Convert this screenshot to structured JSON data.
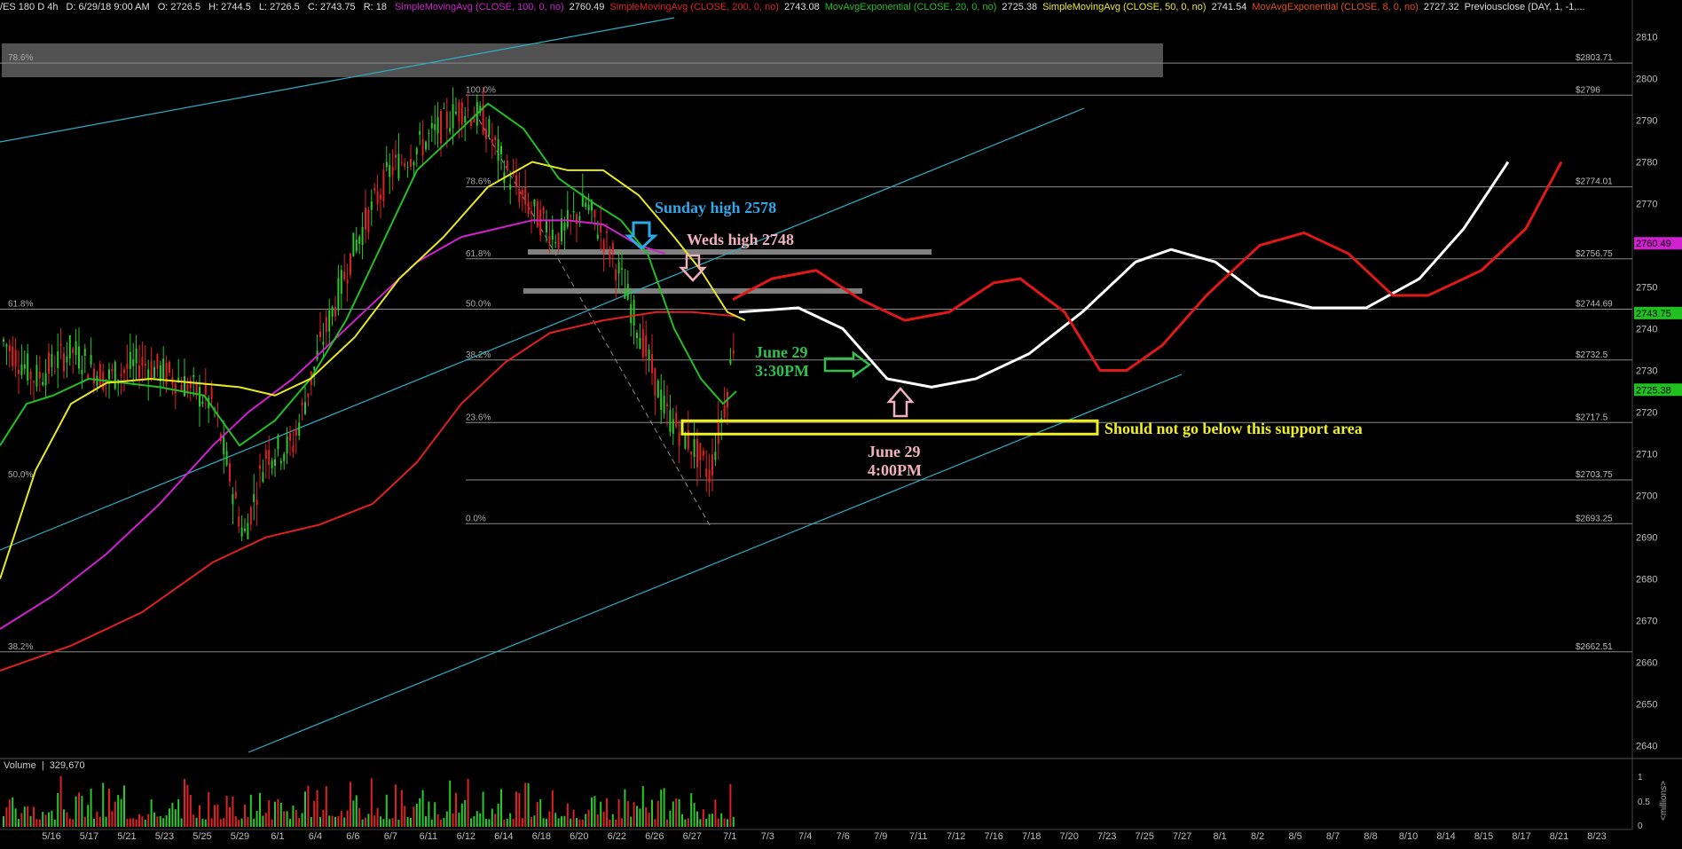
{
  "header": {
    "symbol": "/ES 180 D 4h",
    "date": "D: 6/29/18 9:00 AM",
    "open": "O: 2726.5",
    "high": "H: 2744.5",
    "low": "L: 2726.5",
    "close": "C: 2743.75",
    "range": "R: 18",
    "studies": [
      {
        "label": "SimpleMovingAvg (CLOSE, 100, 0, no)",
        "value": "2760.49",
        "color": "#d020d0"
      },
      {
        "label": "SimpleMovingAvg (CLOSE, 200, 0, no)",
        "value": "2743.08",
        "color": "#e02020"
      },
      {
        "label": "MovAvgExponential (CLOSE, 20, 0, no)",
        "value": "2725.38",
        "color": "#20c020"
      },
      {
        "label": "SimpleMovingAvg (CLOSE, 50, 0, no)",
        "value": "2741.54",
        "color": "#e8e820"
      },
      {
        "label": "MovAvgExponential (CLOSE, 8, 0, no)",
        "value": "2727.32",
        "color": "#e05010"
      },
      {
        "label": "Previousclose (DAY, 1, -1,...",
        "value": "",
        "color": "#dddddd"
      }
    ]
  },
  "chart_data": {
    "type": "line",
    "x_ticks": [
      "5/16",
      "5/17",
      "5/21",
      "5/23",
      "5/25",
      "5/29",
      "6/1",
      "6/4",
      "6/6",
      "6/7",
      "6/11",
      "6/12",
      "6/14",
      "6/18",
      "6/20",
      "6/22",
      "6/26",
      "6/27",
      "7/1",
      "7/3",
      "7/4",
      "7/6",
      "7/9",
      "7/11",
      "7/12",
      "7/16",
      "7/18",
      "7/20",
      "7/23",
      "7/25",
      "7/27",
      "8/1",
      "8/2",
      "8/5",
      "8/7",
      "8/8",
      "8/10",
      "8/14",
      "8/15",
      "8/17",
      "8/21",
      "8/23"
    ],
    "y_ticks": [
      2640,
      2650,
      2660,
      2670,
      2680,
      2690,
      2700,
      2710,
      2720,
      2730,
      2740,
      2750,
      2760,
      2770,
      2780,
      2790,
      2800,
      2810
    ],
    "ylim": [
      2638,
      2815
    ],
    "horizontal_levels": [
      {
        "value": 2803.71,
        "label": "$2803.71"
      },
      {
        "value": 2796,
        "label": "$2796"
      },
      {
        "value": 2774.01,
        "label": "$2774.01"
      },
      {
        "value": 2756.75,
        "label": "$2756.75"
      },
      {
        "value": 2744.69,
        "label": "$2744.69"
      },
      {
        "value": 2732.5,
        "label": "$2732.5"
      },
      {
        "value": 2717.5,
        "label": "$2717.5"
      },
      {
        "value": 2703.75,
        "label": "$2703.75"
      },
      {
        "value": 2693.25,
        "label": "$2693.25"
      },
      {
        "value": 2662.51,
        "label": "$2662.51"
      }
    ],
    "price_tags": [
      {
        "value": 2760.49,
        "label": "2760.49",
        "color": "#d020d0"
      },
      {
        "value": 2743.75,
        "label": "2743.75",
        "color": "#20c020"
      },
      {
        "value": 2725.38,
        "label": "2725.38",
        "color": "#20c020"
      }
    ],
    "fib_right": [
      "100.0%",
      "78.6%",
      "61.8%",
      "50.0%",
      "38.2%",
      "23.6%",
      "0.0%"
    ],
    "fib_left": [
      "78.6%",
      "61.8%",
      "50.0%",
      "38.2%"
    ],
    "series": [
      {
        "name": "SimpleMovingAvg (CLOSE, 100, 0, no)",
        "color": "#d020d0",
        "points": [
          [
            0,
            2668
          ],
          [
            60,
            2676
          ],
          [
            120,
            2686
          ],
          [
            180,
            2698
          ],
          [
            240,
            2712
          ],
          [
            280,
            2720
          ],
          [
            330,
            2728
          ],
          [
            380,
            2738
          ],
          [
            430,
            2748
          ],
          [
            470,
            2756
          ],
          [
            520,
            2762
          ],
          [
            560,
            2764
          ],
          [
            600,
            2766
          ],
          [
            640,
            2766
          ],
          [
            680,
            2765
          ],
          [
            720,
            2760
          ],
          [
            750,
            2758
          ]
        ]
      },
      {
        "name": "SimpleMovingAvg (CLOSE, 200, 0, no)",
        "color": "#e02020",
        "points": [
          [
            0,
            2658
          ],
          [
            80,
            2664
          ],
          [
            160,
            2672
          ],
          [
            240,
            2684
          ],
          [
            300,
            2690
          ],
          [
            360,
            2693
          ],
          [
            420,
            2698
          ],
          [
            470,
            2708
          ],
          [
            520,
            2722
          ],
          [
            570,
            2732
          ],
          [
            620,
            2739
          ],
          [
            680,
            2742
          ],
          [
            740,
            2744
          ],
          [
            780,
            2744
          ],
          [
            830,
            2743
          ]
        ]
      },
      {
        "name": "MovAvgExponential (CLOSE, 20, 0, no)",
        "color": "#20c020",
        "points": [
          [
            0,
            2712
          ],
          [
            30,
            2722
          ],
          [
            60,
            2724
          ],
          [
            100,
            2728
          ],
          [
            140,
            2727
          ],
          [
            180,
            2726
          ],
          [
            230,
            2724
          ],
          [
            270,
            2712
          ],
          [
            310,
            2718
          ],
          [
            350,
            2728
          ],
          [
            390,
            2742
          ],
          [
            430,
            2760
          ],
          [
            470,
            2778
          ],
          [
            510,
            2786
          ],
          [
            550,
            2794
          ],
          [
            590,
            2788
          ],
          [
            630,
            2776
          ],
          [
            670,
            2770
          ],
          [
            700,
            2766
          ],
          [
            730,
            2758
          ],
          [
            760,
            2740
          ],
          [
            790,
            2728
          ],
          [
            815,
            2722
          ],
          [
            830,
            2725
          ]
        ]
      },
      {
        "name": "SimpleMovingAvg (CLOSE, 50, 0, no)",
        "color": "#e8e820",
        "points": [
          [
            0,
            2680
          ],
          [
            40,
            2706
          ],
          [
            80,
            2722
          ],
          [
            120,
            2727
          ],
          [
            170,
            2728
          ],
          [
            220,
            2727
          ],
          [
            270,
            2726
          ],
          [
            310,
            2724
          ],
          [
            350,
            2728
          ],
          [
            400,
            2738
          ],
          [
            450,
            2752
          ],
          [
            500,
            2762
          ],
          [
            550,
            2774
          ],
          [
            600,
            2780
          ],
          [
            640,
            2778
          ],
          [
            680,
            2778
          ],
          [
            720,
            2772
          ],
          [
            760,
            2762
          ],
          [
            790,
            2754
          ],
          [
            820,
            2744
          ],
          [
            840,
            2742
          ]
        ]
      },
      {
        "name": "Projection white",
        "color": "#ffffff",
        "points": [
          [
            833,
            2744
          ],
          [
            900,
            2745
          ],
          [
            950,
            2740
          ],
          [
            1000,
            2728
          ],
          [
            1050,
            2726
          ],
          [
            1100,
            2728
          ],
          [
            1160,
            2734
          ],
          [
            1220,
            2744
          ],
          [
            1280,
            2756
          ],
          [
            1320,
            2759
          ],
          [
            1370,
            2756
          ],
          [
            1420,
            2748
          ],
          [
            1480,
            2745
          ],
          [
            1540,
            2745
          ],
          [
            1600,
            2752
          ],
          [
            1650,
            2764
          ],
          [
            1700,
            2780
          ]
        ]
      },
      {
        "name": "Projection red",
        "color": "#e01818",
        "points": [
          [
            826,
            2747
          ],
          [
            870,
            2752
          ],
          [
            920,
            2754
          ],
          [
            970,
            2747
          ],
          [
            1020,
            2742
          ],
          [
            1070,
            2744
          ],
          [
            1120,
            2751
          ],
          [
            1150,
            2752
          ],
          [
            1200,
            2744
          ],
          [
            1240,
            2730
          ],
          [
            1270,
            2730
          ],
          [
            1310,
            2736
          ],
          [
            1360,
            2748
          ],
          [
            1420,
            2760
          ],
          [
            1470,
            2763
          ],
          [
            1520,
            2758
          ],
          [
            1570,
            2748
          ],
          [
            1610,
            2748
          ],
          [
            1670,
            2754
          ],
          [
            1720,
            2764
          ],
          [
            1760,
            2780
          ]
        ]
      }
    ],
    "volume": {
      "label": "Volume",
      "value": "329,670",
      "axis": [
        "1",
        "0.5",
        "0"
      ],
      "unit": "<millions>"
    }
  },
  "annotations": {
    "sunday_high": "Sunday high 2578",
    "weds_high": "Weds high 2748",
    "june29_330_line1": "June 29",
    "june29_330_line2": "3:30PM",
    "june29_400_line1": "June 29",
    "june29_400_line2": "4:00PM",
    "support": "Should not go below this support area"
  },
  "colors": {
    "bg": "#000000",
    "grid": "#8a8a8a",
    "channel": "#2cb0c8",
    "sunday": "#2ea8e8",
    "weds": "#f0b0c0",
    "june330": "#30c050",
    "june400": "#f0b0c0",
    "support": "#f0f020"
  }
}
